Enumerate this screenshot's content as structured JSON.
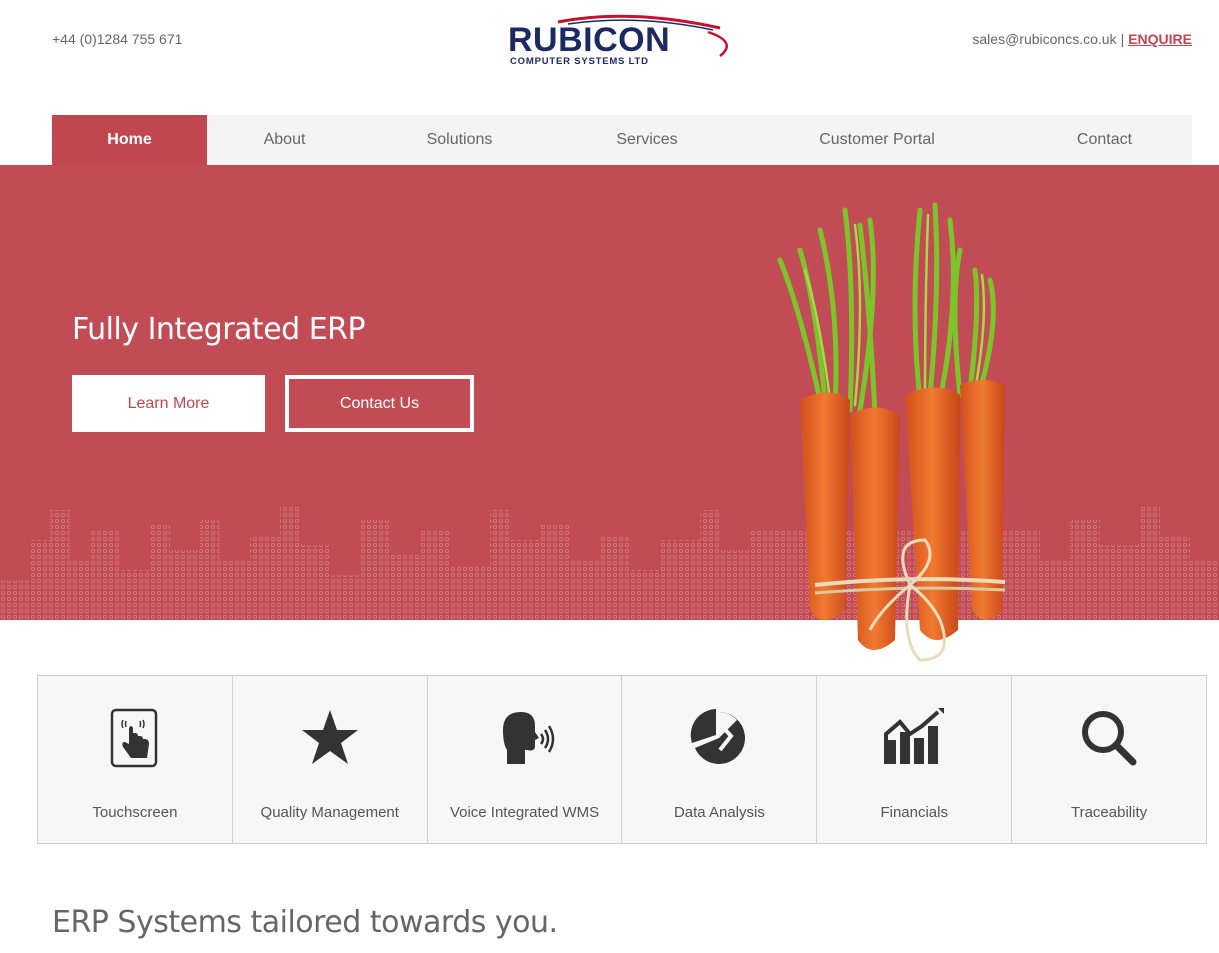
{
  "header": {
    "phone": "+44 (0)1284 755 671",
    "email": "sales@rubiconcs.co.uk",
    "separator": "|",
    "enquire_label": "ENQUIRE",
    "logo": {
      "name": "RUBICON",
      "subtitle": "COMPUTER SYSTEMS LTD",
      "colors": {
        "navy": "#1b2a63",
        "red": "#c8102e"
      }
    }
  },
  "nav": {
    "items": [
      {
        "label": "Home",
        "active": true
      },
      {
        "label": "About",
        "active": false
      },
      {
        "label": "Solutions",
        "active": false
      },
      {
        "label": "Services",
        "active": false
      },
      {
        "label": "Customer Portal",
        "active": false
      },
      {
        "label": "Contact",
        "active": false
      }
    ]
  },
  "hero": {
    "title": "Fully Integrated ERP",
    "learn_more_label": "Learn More",
    "contact_label": "Contact Us",
    "image": "carrots-bunch"
  },
  "features": [
    {
      "label": "Touchscreen",
      "icon": "touchscreen-icon"
    },
    {
      "label": "Quality Management",
      "icon": "star-icon"
    },
    {
      "label": "Voice Integrated WMS",
      "icon": "voice-icon"
    },
    {
      "label": "Data Analysis",
      "icon": "pie-chart-icon"
    },
    {
      "label": "Financials",
      "icon": "financials-chart-icon"
    },
    {
      "label": "Traceability",
      "icon": "magnifier-icon"
    }
  ],
  "tagline": "ERP Systems tailored towards you.",
  "colors": {
    "accent": "#c0474f",
    "hero_bg": "#c14c55",
    "nav_bg": "#f4f4f4",
    "feature_bg": "#f7f7f7"
  }
}
